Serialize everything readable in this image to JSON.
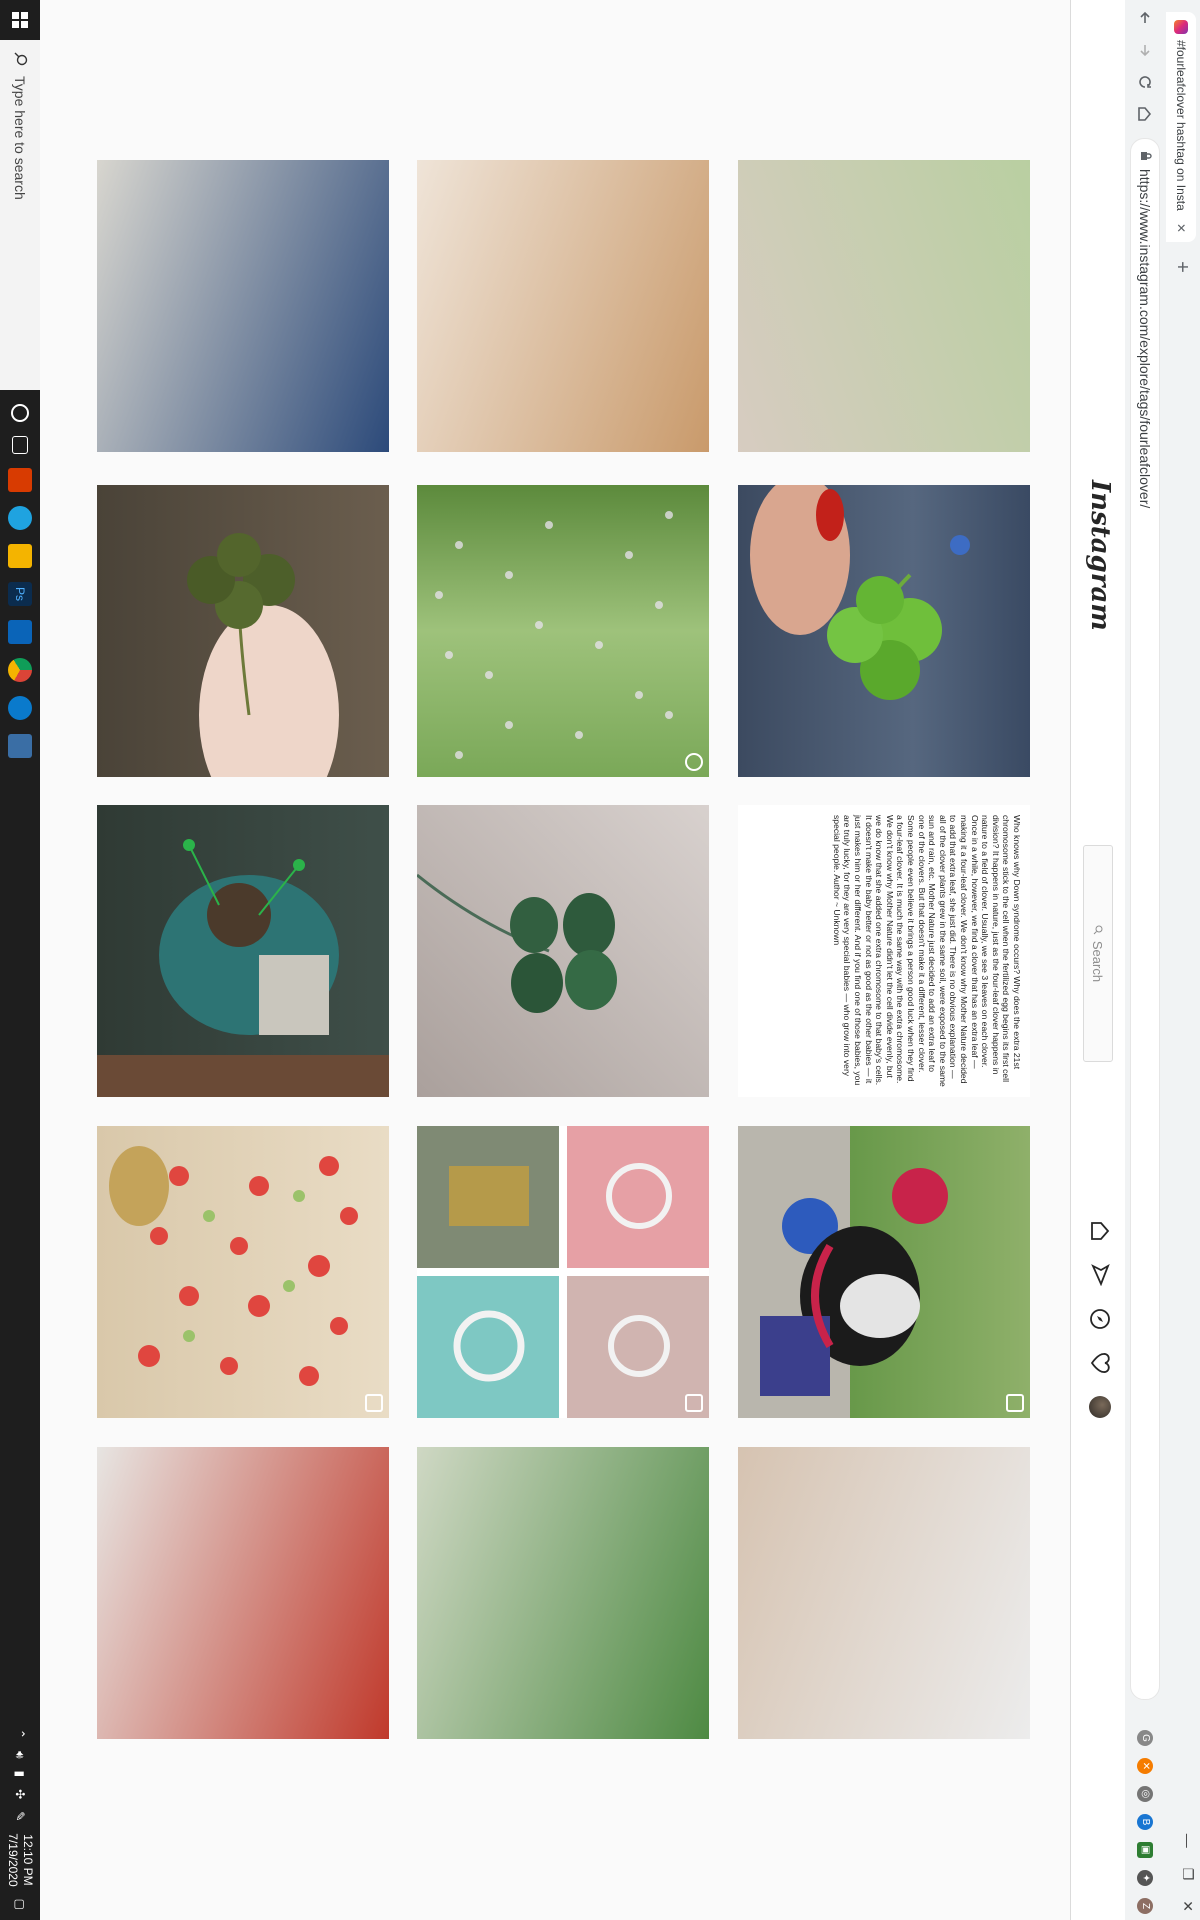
{
  "browser": {
    "tab_title": "#fourleafclover hashtag on Insta",
    "tab_close": "✕",
    "new_tab": "+",
    "url": "https://www.instagram.com/explore/tags/fourleafclover/",
    "window_controls": [
      "—",
      "❐",
      "✕"
    ],
    "extensions": [
      {
        "name": "ext-g",
        "color": "#888888",
        "glyph": "G"
      },
      {
        "name": "ext-orange",
        "color": "#f57c00",
        "glyph": "✕"
      },
      {
        "name": "ext-circle",
        "color": "#757575",
        "glyph": "◎"
      },
      {
        "name": "ext-blue",
        "color": "#1976d2",
        "glyph": "B"
      },
      {
        "name": "ext-green",
        "color": "#2e7d32",
        "glyph": "▣"
      },
      {
        "name": "ext-puzzle",
        "color": "#555555",
        "glyph": "✦"
      },
      {
        "name": "ext-avatar",
        "color": "#8d6e63",
        "glyph": "Z"
      }
    ]
  },
  "instagram": {
    "logo": "Instagram",
    "search_placeholder": "Search"
  },
  "grid": {
    "text_post": "Who knows why Down syndrome occurs? Why does the extra 21st chromosome stick to the cell when the fertilized egg begins its first cell division? It happens in nature, just as the four-leaf clover happens in nature to a field of clover. Usually, we see 3 leaves on each clover. Once in a while, however, we find a clover that has an extra leaf — making it a four-leaf clover. We don't know why Mother Nature decided to add that extra leaf, she just did. There is no obvious explanation — all of the clover plants grew in the same soil, were exposed to the same sun and rain, etc. Mother Nature just decided to add an extra leaf to one of the clovers. But that doesn't make it a different, lesser clover. Some people even believe it brings a person good luck when they find a four-leaf clover. It is much the same way with the extra chromosome. We don't know why Mother Nature didn't let the cell divide evenly, but we do know that she added one extra chromosome to that baby's cells. It doesn't make the baby better or not as good as the other babies — it just makes him or her different. And if you find one of those babies, you are truly lucky, for they are very special babies — who grow into very special people. Author ~ Unknown"
  },
  "taskbar": {
    "search_placeholder": "Type here to search",
    "time": "12:10 PM",
    "date": "7/19/2020"
  }
}
